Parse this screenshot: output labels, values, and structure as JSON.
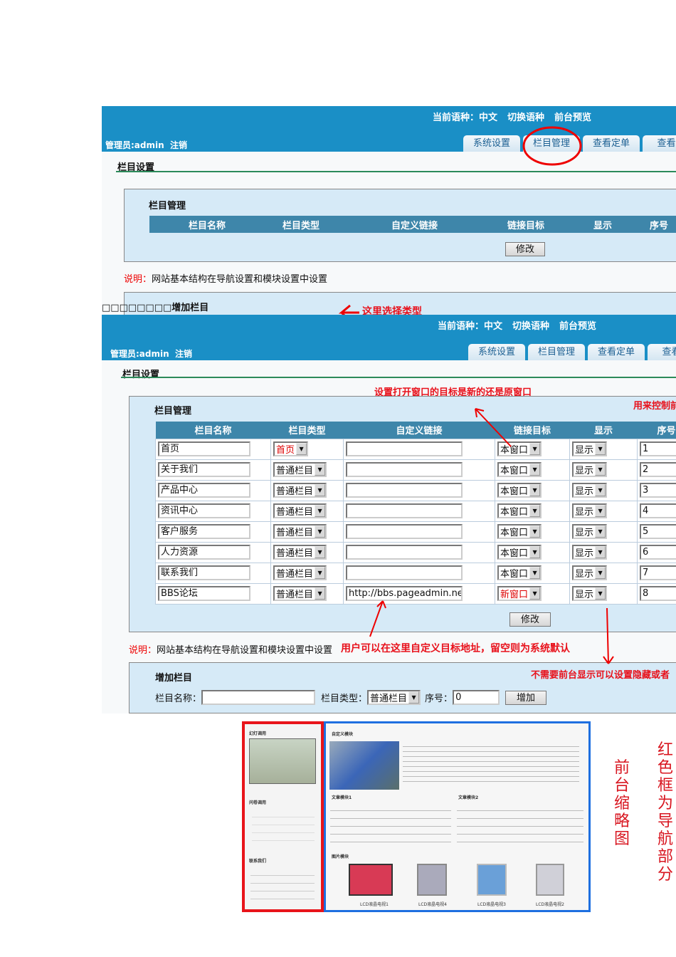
{
  "header": {
    "current_lang": "当前语种：中文",
    "switch_lang": "切换语种",
    "preview": "前台预览",
    "admin": "管理员:admin",
    "logout": "注销"
  },
  "tabs": [
    "系统设置",
    "栏目管理",
    "查看定单",
    "查看留"
  ],
  "section_title": "栏目设置",
  "panel_title": "栏目管理",
  "columns": [
    "栏目名称",
    "栏目类型",
    "自定义链接",
    "链接目标",
    "显示",
    "序号"
  ],
  "modify_btn": "修改",
  "note_label": "说明：",
  "note_text": "网站基本结构在导航设置和模块设置中设置",
  "add_panel": {
    "title": "增加栏目",
    "garbled_prefix": "□□□□□□□□",
    "name_label": "栏目名称：",
    "type_label": "栏目类型：",
    "type_value": "普通栏目",
    "order_label": "序号：",
    "order_value": "0",
    "add_btn": "增加"
  },
  "rows": [
    {
      "name": "首页",
      "type": "首页",
      "link": "",
      "target": "本窗口",
      "show": "显示",
      "order": "1"
    },
    {
      "name": "关于我们",
      "type": "普通栏目",
      "link": "",
      "target": "本窗口",
      "show": "显示",
      "order": "2"
    },
    {
      "name": "产品中心",
      "type": "普通栏目",
      "link": "",
      "target": "本窗口",
      "show": "显示",
      "order": "3"
    },
    {
      "name": "资讯中心",
      "type": "普通栏目",
      "link": "",
      "target": "本窗口",
      "show": "显示",
      "order": "4"
    },
    {
      "name": "客户服务",
      "type": "普通栏目",
      "link": "",
      "target": "本窗口",
      "show": "显示",
      "order": "5"
    },
    {
      "name": "人力资源",
      "type": "普通栏目",
      "link": "",
      "target": "本窗口",
      "show": "显示",
      "order": "6"
    },
    {
      "name": "联系我们",
      "type": "普通栏目",
      "link": "",
      "target": "本窗口",
      "show": "显示",
      "order": "7"
    },
    {
      "name": "BBS论坛",
      "type": "普通栏目",
      "link": "http://bbs.pageadmin.net/",
      "target": "新窗口",
      "show": "显示",
      "order": "8"
    }
  ],
  "annotations": {
    "choose_type": "这里选择类型",
    "target": "设置打开窗口的目标是新的还是原窗口",
    "control": "用来控制前",
    "custom_link": "用户可以在这里自定义目标地址，留空则为系统默认",
    "hide": "不需要前台显示可以设置隐藏或者",
    "thumb_label": "前台缩略图",
    "red_box": "红色框为导航部分"
  },
  "thumb": {
    "slide": "幻灯调用",
    "survey": "问卷调用",
    "contact": "联系我们",
    "custom": "自定义模块",
    "art1": "文章模块1",
    "art2": "文章模块2",
    "pics": "图片模块",
    "tv": [
      "LCD液晶电视1",
      "LCD液晶电视4",
      "LCD液晶电视3",
      "LCD液晶电视2"
    ]
  }
}
